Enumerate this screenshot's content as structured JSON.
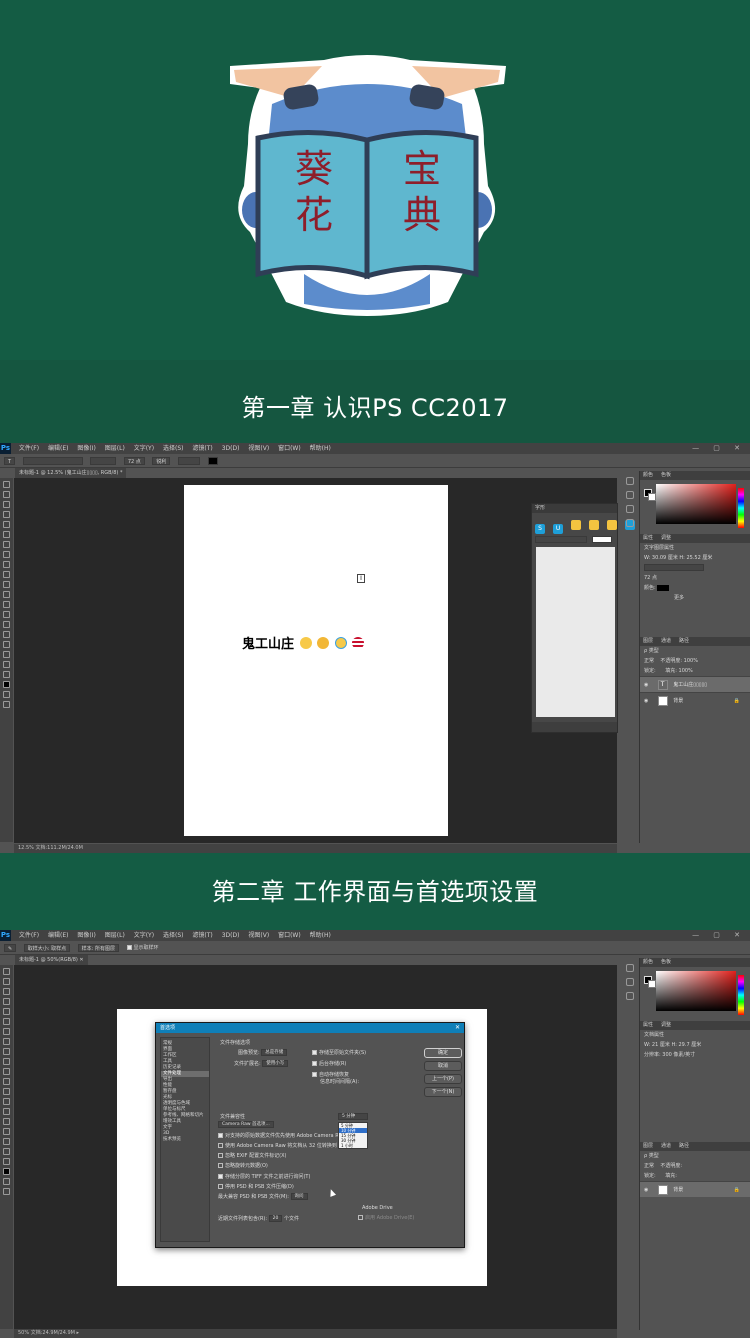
{
  "logo": {
    "left_page": "葵\n花",
    "right_page": "宝\n典",
    "colors": {
      "book": "#5fb7cf",
      "head": "#5c8ccc",
      "ear": "#f2c4a1",
      "text": "#8e1e2a"
    }
  },
  "chapter1": {
    "title": "第一章 认识PS CC2017"
  },
  "chapter2": {
    "title": "第二章 工作界面与首选项设置"
  },
  "ps1": {
    "app_logo": "Ps",
    "menu": [
      "文件(F)",
      "编辑(E)",
      "图像(I)",
      "图层(L)",
      "文字(Y)",
      "选择(S)",
      "滤镜(T)",
      "3D(D)",
      "视图(V)",
      "窗口(W)",
      "帮助(H)"
    ],
    "window_controls": "— ▢ ✕",
    "options": {
      "tool_icon": "T",
      "font_size": "72 点",
      "aa": "锐利"
    },
    "doc_tab": "未标题-1 @ 12.5% (鬼工山庄▯▯▯▯, RGB/8) *",
    "canvas_text": "鬼工山庄",
    "cursor_glyph": "I",
    "glyph_panel": {
      "title": "字形",
      "buttons": [
        "S",
        "U"
      ]
    },
    "color_tab": [
      "颜色",
      "色板"
    ],
    "props_tab": [
      "属性",
      "调整"
    ],
    "props_title": "文字图层属性",
    "props_wh": "W: 30.09 厘米   H: 25.52 厘米",
    "props_font": "72 点",
    "props_color_label": "颜色:",
    "props_more": "更多",
    "layers_tab": [
      "图层",
      "通道",
      "路径"
    ],
    "layers_kind": "ρ 类型",
    "layers_blend": "正常",
    "layers_opacity": "不透明度: 100%",
    "layers_lock": "锁定:",
    "layers_fill": "填充: 100%",
    "layers": [
      {
        "name": "鬼工山庄▯▯▯▯▯",
        "type": "text",
        "selected": true
      },
      {
        "name": "背景",
        "type": "bg",
        "selected": false
      }
    ],
    "status": "12.5%      文档:111.2M/24.0M"
  },
  "ps2": {
    "app_logo": "Ps",
    "menu": [
      "文件(F)",
      "编辑(E)",
      "图像(I)",
      "图层(L)",
      "文字(Y)",
      "选择(S)",
      "滤镜(T)",
      "3D(D)",
      "视图(V)",
      "窗口(W)",
      "帮助(H)"
    ],
    "window_controls": "— ▢ ✕",
    "options": [
      "取样大小: 取样点",
      "样本: 所有图层",
      "显示取样环"
    ],
    "doc_tab": "未标题-1 @ 50%(RGB/8)  ✕",
    "dialog_title": "首选项",
    "dialog_close": "✕",
    "nav": [
      "常规",
      "界面",
      "工作区",
      "工具",
      "历史记录",
      "文件处理",
      "导出",
      "性能",
      "暂存盘",
      "光标",
      "透明度与色域",
      "单位与标尺",
      "参考线、网格和切片",
      "增效工具",
      "文字",
      "3D",
      "技术预览"
    ],
    "nav_selected_index": 5,
    "section1": "文件存储选项",
    "preview_label": "图像预览:",
    "preview_value": "总是存储",
    "ext_label": "文件扩展名:",
    "ext_value": "使用小写",
    "chk_save_as_original": "存储至原始文件夹(S)",
    "chk_bg_save": "后台存储(R)",
    "chk_auto_save": "自动存储恢复",
    "auto_save_interval": "信息时间间隔(A):",
    "dropdown": [
      "5 分钟",
      "10 分钟",
      "15 分钟",
      "30 分钟",
      "1 小时"
    ],
    "dropdown_selected": "10 分钟",
    "section2": "文件兼容性",
    "camera_raw_btn": "Camera Raw 首选项...",
    "compat_lines": [
      "对支持的原始数据文件优先使用 Adobe Camera Raw(C)",
      "使用 Adobe Camera Raw 将文档从 32 位转换到 16/8 位(U)",
      "忽略 EXIF 配置文件标记(X)",
      "忽略旋转元数据(O)",
      "存储分层的 TIFF 文件之前进行询问(T)",
      "停用 PSD 和 PSB 文件压缩(D)"
    ],
    "max_compat_label": "最大兼容 PSD 和 PSB 文件(M):",
    "max_compat_value": "询问",
    "adobe_drive_title": "Adobe Drive",
    "adobe_drive_chk": "启用 Adobe Drive(E)",
    "recent_label": "近期文件列表包含(R):",
    "recent_value": "20",
    "recent_unit": "个文件",
    "buttons": [
      "确定",
      "取消",
      "上一个(P)",
      "下一个(N)"
    ],
    "color_tab": [
      "颜色",
      "色板"
    ],
    "props_tab": [
      "属性",
      "调整"
    ],
    "props_title": "文档属性",
    "props_wh": "W: 21 厘米   H: 29.7 厘米",
    "props_res": "分辨率: 300 像素/英寸",
    "layers_tab": [
      "图层",
      "通道",
      "路径"
    ],
    "layers_kind": "ρ 类型",
    "layers_blend": "正常",
    "layers_opacity": "不透明度:",
    "layers_lock": "锁定:",
    "layers_fill": "填充:",
    "layer_name": "背景",
    "status": "50%      文档:24.9M/24.9M  ▸"
  }
}
